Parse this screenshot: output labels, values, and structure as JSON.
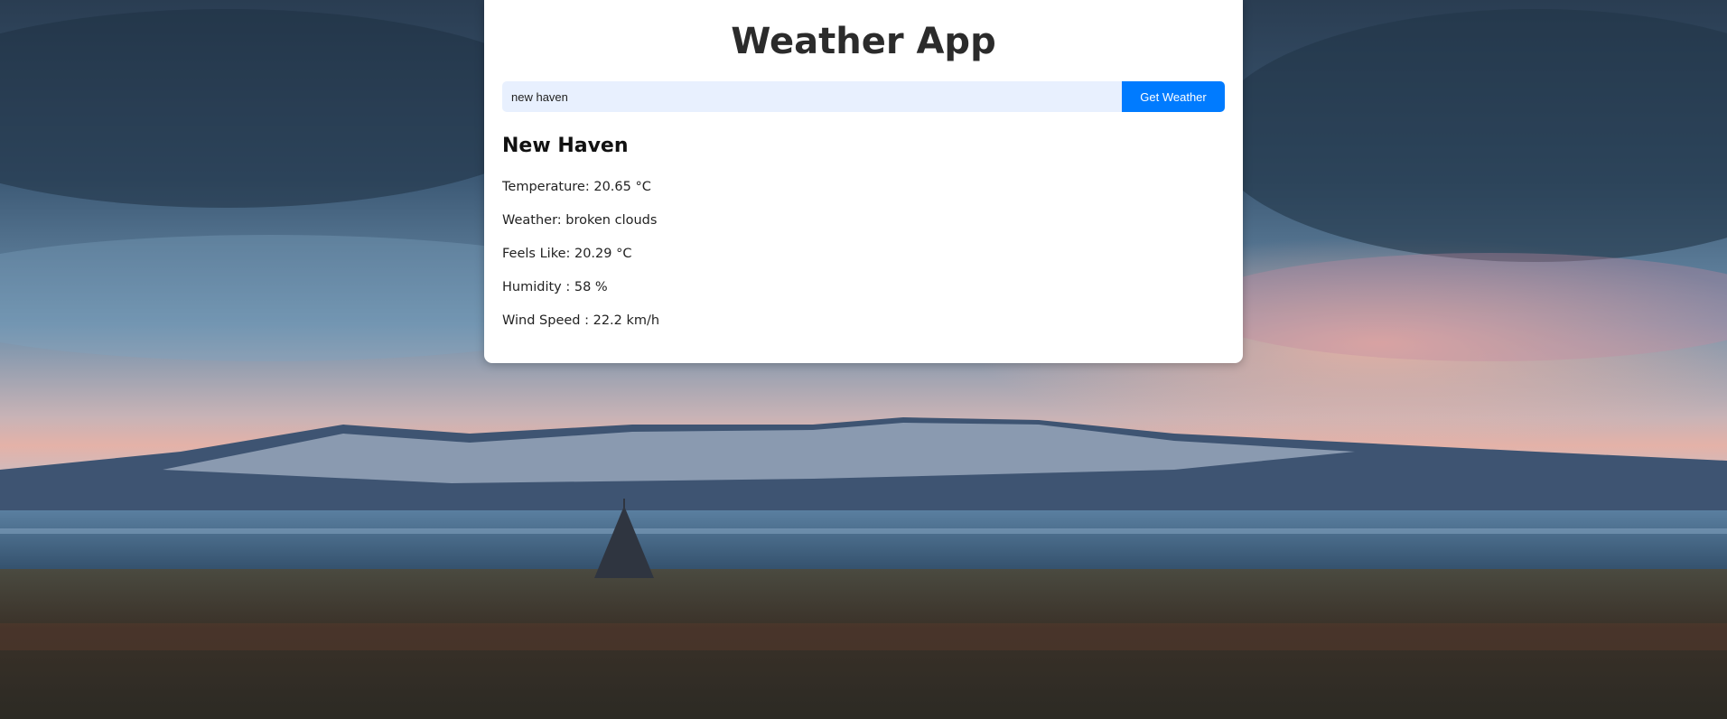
{
  "app": {
    "title": "Weather App"
  },
  "search": {
    "value": "new haven",
    "button_label": "Get Weather"
  },
  "result": {
    "city": "New Haven",
    "temperature": "Temperature: 20.65 °C",
    "weather": "Weather: broken clouds",
    "feels_like": "Feels Like: 20.29 °C",
    "humidity": "Humidity : 58 %",
    "wind_speed": "Wind Speed : 22.2 km/h"
  },
  "colors": {
    "accent": "#007bff",
    "input_background": "#e8f0fe",
    "card_background": "#ffffff"
  }
}
